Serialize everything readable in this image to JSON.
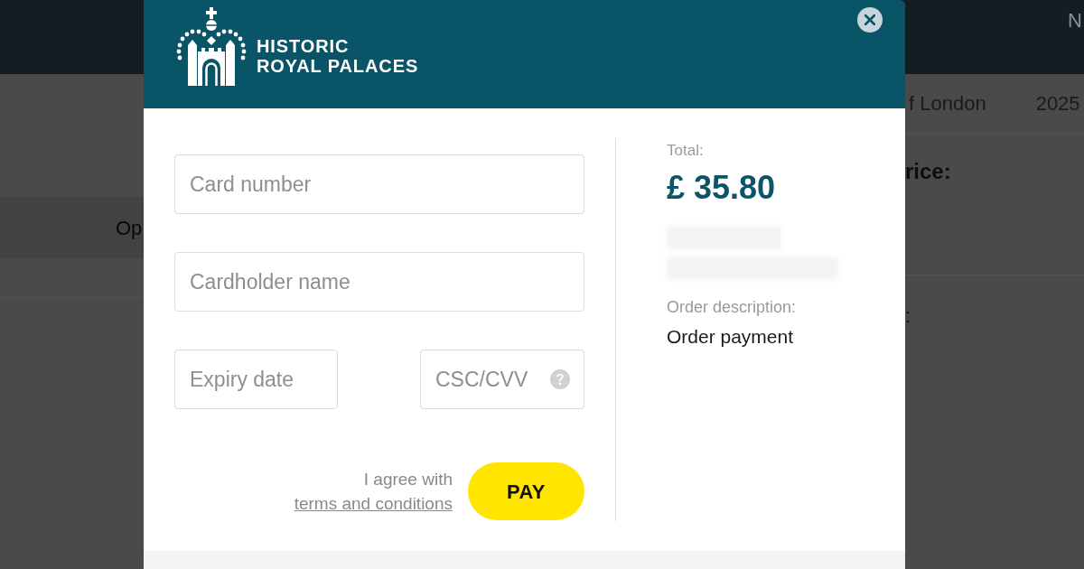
{
  "background_page": {
    "top_bar_text": "N",
    "band_text": "Op",
    "row_texts": [
      "f London",
      "2025"
    ],
    "heading": "rice:",
    "label": ":"
  },
  "dialog": {
    "logo": {
      "lines": [
        "HISTORIC",
        "ROYAL PALACES"
      ]
    },
    "form": {
      "fields": [
        {
          "kind": "wide",
          "placeholder": "Card number"
        },
        {
          "kind": "wide",
          "placeholder": "Cardholder name"
        },
        {
          "kind": "narrow",
          "placeholder": "Expiry date"
        },
        {
          "kind": "narrow-help",
          "placeholder": "CSC/CVV"
        }
      ],
      "agreement": {
        "text": "I agree with",
        "link": "terms and conditions"
      },
      "pay_button": "PAY"
    },
    "summary": {
      "total_label": "Total:",
      "total": "£ 35.80",
      "description_label": "Order description:",
      "description": "Order payment"
    }
  }
}
